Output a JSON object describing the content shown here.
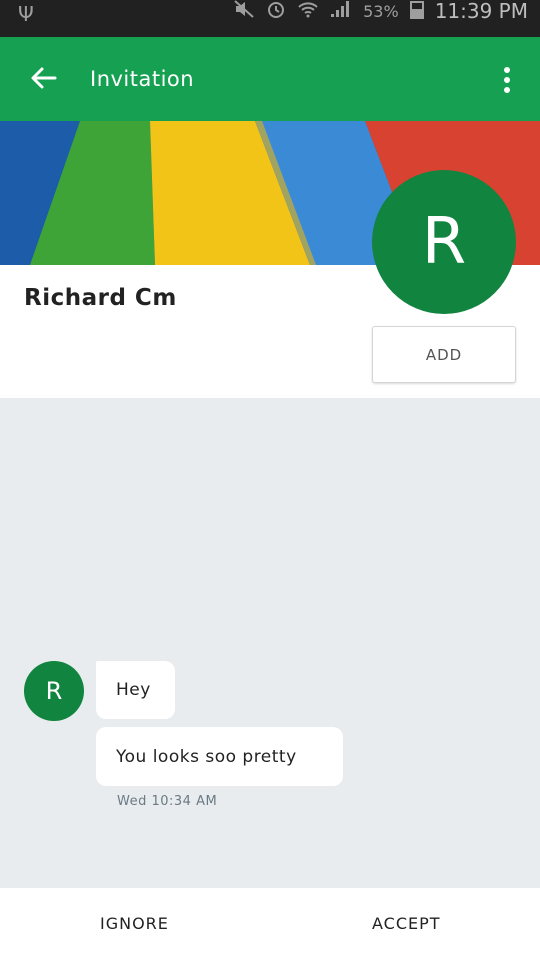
{
  "status_bar": {
    "battery": "53%",
    "time": "11:39 PM"
  },
  "app_bar": {
    "title": "Invitation"
  },
  "profile": {
    "name": "Richard Cm",
    "avatar_letter": "R",
    "add_label": "ADD"
  },
  "chat": {
    "avatar_letter": "R",
    "messages": [
      {
        "text": "Hey"
      },
      {
        "text": "You looks soo pretty"
      }
    ],
    "timestamp": "Wed 10:34 AM"
  },
  "actions": {
    "ignore_label": "IGNORE",
    "accept_label": "ACCEPT"
  },
  "colors": {
    "primary": "#16a052",
    "avatar": "#11843f",
    "chat_bg": "#e8ecee"
  }
}
